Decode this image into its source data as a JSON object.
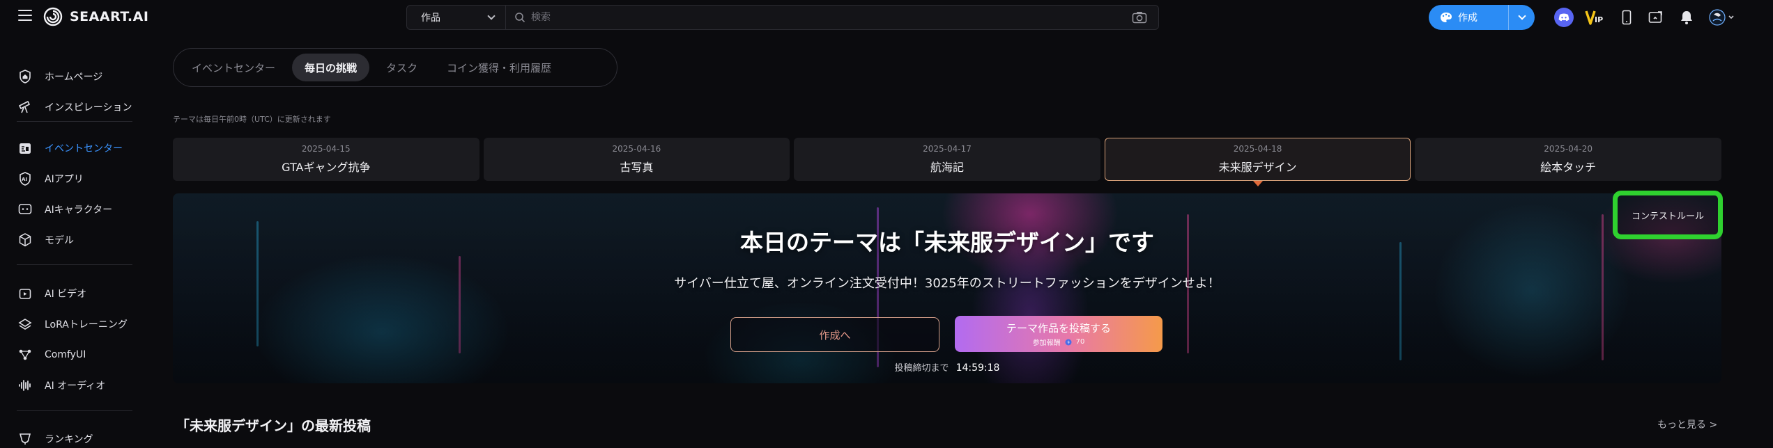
{
  "app": {
    "logo_text": "SEAART.AI"
  },
  "search": {
    "category": "作品",
    "placeholder": "検索"
  },
  "header": {
    "create_label": "作成"
  },
  "sidebar": {
    "items": [
      {
        "label": "ホームページ",
        "icon": "home-shield-icon"
      },
      {
        "label": "インスピレーション",
        "icon": "telescope-icon"
      },
      {
        "label": "イベントセンター",
        "icon": "event-center-icon",
        "active": true
      },
      {
        "label": "AIアプリ",
        "icon": "ai-app-icon"
      },
      {
        "label": "AIキャラクター",
        "icon": "ai-character-icon"
      },
      {
        "label": "モデル",
        "icon": "cube-icon"
      },
      {
        "label": "AI ビデオ",
        "icon": "video-icon"
      },
      {
        "label": "LoRAトレーニング",
        "icon": "lora-icon"
      },
      {
        "label": "ComfyUI",
        "icon": "comfyui-icon"
      },
      {
        "label": "AI オーディオ",
        "icon": "audio-wave-icon"
      },
      {
        "label": "ランキング",
        "icon": "ranking-icon"
      }
    ]
  },
  "tabs": [
    {
      "label": "イベントセンター",
      "active": false
    },
    {
      "label": "毎日の挑戦",
      "active": true
    },
    {
      "label": "タスク",
      "active": false
    },
    {
      "label": "コイン獲得・利用履歴",
      "active": false
    }
  ],
  "update_note": "テーマは毎日午前0時（UTC）に更新されます",
  "days": [
    {
      "date": "2025-04-15",
      "theme": "GTAギャング抗争"
    },
    {
      "date": "2025-04-16",
      "theme": "古写真"
    },
    {
      "date": "2025-04-17",
      "theme": "航海記"
    },
    {
      "date": "2025-04-18",
      "theme": "未来服デザイン",
      "active": true
    },
    {
      "date": "2025-04-20",
      "theme": "絵本タッチ"
    }
  ],
  "banner": {
    "title": "本日のテーマは「未来服デザイン」です",
    "subtitle": "サイバー仕立て屋、オンライン注文受付中！3025年のストリートファッションをデザインせよ！",
    "goto_label": "作成へ",
    "post_label": "テーマ作品を投稿する",
    "reward_label": "参加報酬",
    "reward_amount": "70",
    "deadline_label": "投稿締切まで",
    "deadline_time": "14:59:18",
    "rules_label": "コンテストルール"
  },
  "section": {
    "title": "「未来服デザイン」の最新投稿",
    "more_label": "もっと見る >"
  },
  "colors": {
    "accent_blue": "#2b8cf5",
    "active_sidebar": "#3b94ff",
    "highlight_green": "#2fd12f",
    "post_gradient_start": "#b26bf0",
    "post_gradient_end": "#f59a4a"
  }
}
